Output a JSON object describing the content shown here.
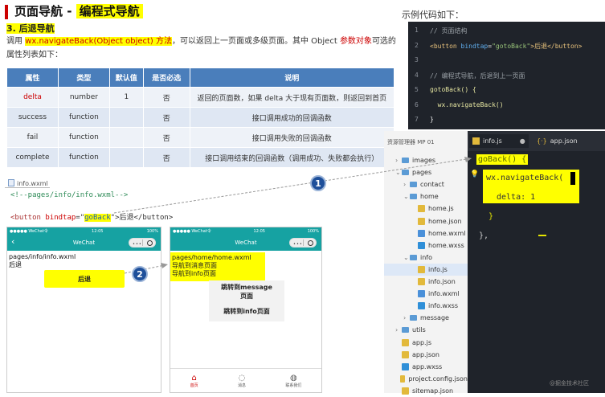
{
  "header": {
    "title_prefix": "页面导航 - ",
    "title_highlight": "编程式导航",
    "section": "3. 后退导航",
    "desc_line1_a": "调用 ",
    "desc_api": "wx.navigateBack(Object object) 方法",
    "desc_line1_b": "，可以返回上一页面或多级页面。其中 Object ",
    "desc_param": "参数对象",
    "desc_line1_c": "可选的",
    "desc_line2": "属性列表如下："
  },
  "params_table": {
    "headers": [
      "属性",
      "类型",
      "默认值",
      "是否必选",
      "说明"
    ],
    "rows": [
      [
        "delta",
        "number",
        "1",
        "否",
        "返回的页面数，如果 delta 大于现有页面数，则返回到首页"
      ],
      [
        "success",
        "function",
        "",
        "否",
        "接口调用成功的回调函数"
      ],
      [
        "fail",
        "function",
        "",
        "否",
        "接口调用失败的回调函数"
      ],
      [
        "complete",
        "function",
        "",
        "否",
        "接口调用结束的回调函数（调用成功、失败都会执行）"
      ]
    ]
  },
  "code_sample": {
    "label": "示例代码如下：",
    "lines": [
      {
        "n": "1",
        "parts": [
          {
            "t": "// 页面结构",
            "c": "c-com"
          }
        ]
      },
      {
        "n": "2",
        "parts": [
          {
            "t": "<button ",
            "c": "c-tag"
          },
          {
            "t": "bindtap",
            "c": "c-attr"
          },
          {
            "t": "=",
            "c": ""
          },
          {
            "t": "\"gotoBack\"",
            "c": "c-str"
          },
          {
            "t": ">后退</button>",
            "c": "c-tag"
          }
        ]
      },
      {
        "n": "3",
        "parts": []
      },
      {
        "n": "4",
        "parts": [
          {
            "t": "// 编程式导航，后退到上一页面",
            "c": "c-com"
          }
        ]
      },
      {
        "n": "5",
        "parts": [
          {
            "t": "gotoBack() {",
            "c": "c-fn"
          }
        ]
      },
      {
        "n": "6",
        "parts": [
          {
            "t": "  wx.navigateBack()",
            "c": "c-fn"
          }
        ]
      },
      {
        "n": "7",
        "parts": [
          {
            "t": "}",
            "c": ""
          }
        ]
      }
    ]
  },
  "wxml": {
    "file": "info.wxml",
    "comment": "<!--pages/info/info.wxml-->",
    "btn_open": "<button ",
    "btn_attr": "bindtap",
    "btn_eq": "=\"",
    "btn_value": "goBack",
    "btn_close": "\">后退</button>"
  },
  "phone_left": {
    "carrier": "●●●●● WeChat令",
    "time": "12:05",
    "battery": "100%",
    "nav_title": "WeChat",
    "path": "pages/info/info.wxml",
    "text": "后退",
    "button": "后退",
    "back_icon": "‹"
  },
  "phone_right": {
    "carrier": "●●●●● WeChat令",
    "time": "12:05",
    "battery": "100%",
    "nav_title": "WeChat",
    "lines": [
      "pages/home/home.wxml",
      "导航到消息页面",
      "导航到info页面"
    ],
    "btn_message": "跳转到message\n页面",
    "btn_info": "跳转到info页面",
    "tabs": [
      {
        "icon": "home-icon",
        "label": "首页",
        "active": true
      },
      {
        "icon": "message-icon",
        "label": "消息",
        "active": false
      },
      {
        "icon": "contact-icon",
        "label": "联系我们",
        "active": false
      }
    ]
  },
  "steps": [
    "1",
    "2"
  ],
  "explorer": {
    "header": "资源管理器 MP 01",
    "items": [
      {
        "label": "images",
        "kind": "folder",
        "indent": 1,
        "caret": "›"
      },
      {
        "label": "pages",
        "kind": "folder",
        "indent": 1,
        "caret": "⌄"
      },
      {
        "label": "contact",
        "kind": "folder",
        "indent": 2,
        "caret": "›"
      },
      {
        "label": "home",
        "kind": "folder",
        "indent": 2,
        "caret": "⌄"
      },
      {
        "label": "home.js",
        "kind": "js",
        "indent": 3,
        "caret": ""
      },
      {
        "label": "home.json",
        "kind": "json",
        "indent": 3,
        "caret": ""
      },
      {
        "label": "home.wxml",
        "kind": "wxml",
        "indent": 3,
        "caret": ""
      },
      {
        "label": "home.wxss",
        "kind": "wxss",
        "indent": 3,
        "caret": ""
      },
      {
        "label": "info",
        "kind": "folder",
        "indent": 2,
        "caret": "⌄"
      },
      {
        "label": "info.js",
        "kind": "js",
        "indent": 3,
        "caret": "",
        "selected": true
      },
      {
        "label": "info.json",
        "kind": "json",
        "indent": 3,
        "caret": ""
      },
      {
        "label": "info.wxml",
        "kind": "wxml",
        "indent": 3,
        "caret": ""
      },
      {
        "label": "info.wxss",
        "kind": "wxss",
        "indent": 3,
        "caret": ""
      },
      {
        "label": "message",
        "kind": "folder",
        "indent": 2,
        "caret": "›"
      },
      {
        "label": "utils",
        "kind": "folder",
        "indent": 1,
        "caret": "›"
      },
      {
        "label": "app.js",
        "kind": "js",
        "indent": 1,
        "caret": ""
      },
      {
        "label": "app.json",
        "kind": "json",
        "indent": 1,
        "caret": ""
      },
      {
        "label": "app.wxss",
        "kind": "wxss",
        "indent": 1,
        "caret": ""
      },
      {
        "label": "project.config.json",
        "kind": "json",
        "indent": 1,
        "caret": ""
      },
      {
        "label": "sitemap.json",
        "kind": "json",
        "indent": 1,
        "caret": ""
      }
    ]
  },
  "editor": {
    "tab_active": "info.js",
    "tab_modified": "●",
    "tab_other": "app.json",
    "line1": "goBack() {",
    "line2": "wx.navigateBack(",
    "line3": "delta: 1",
    "line4": "}",
    "line5": "},"
  },
  "watermark": "@掘金技术社区",
  "colors": {
    "header": "#4a7ebb",
    "teal": "#16a2a2",
    "highlight": "#ffff00",
    "step": "#1e4f9a"
  }
}
